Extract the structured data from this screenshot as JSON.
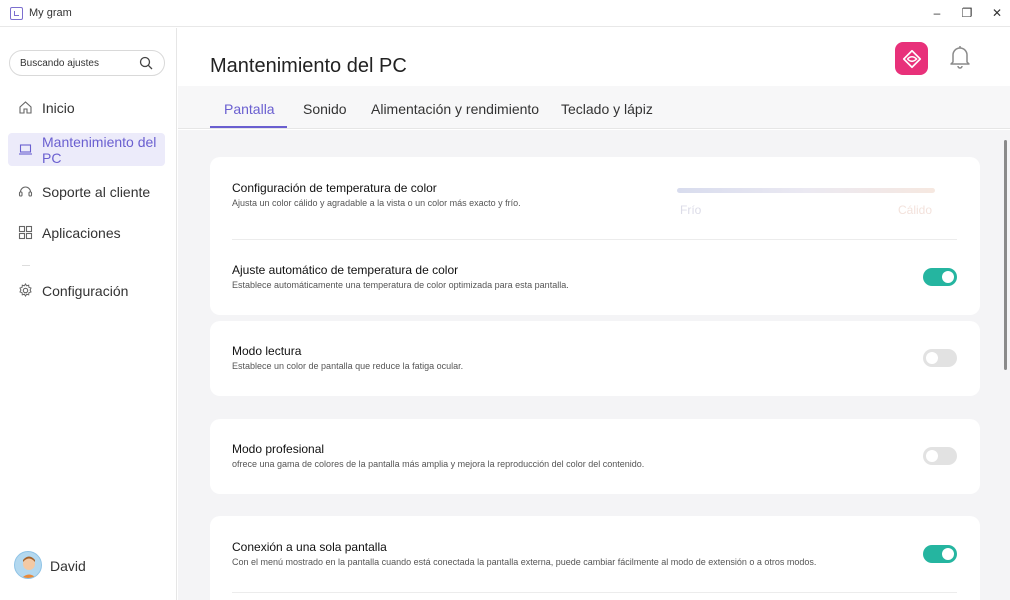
{
  "window": {
    "title": "My gram",
    "minimize": "–",
    "maximize": "❐",
    "close": "✕"
  },
  "sidebar": {
    "search_placeholder": "Buscando ajustes",
    "items": [
      {
        "label": "Inicio",
        "icon": "home-icon"
      },
      {
        "label": "Mantenimiento del PC",
        "icon": "laptop-icon",
        "active": true
      },
      {
        "label": "Soporte al cliente",
        "icon": "headset-icon"
      },
      {
        "label": "Aplicaciones",
        "icon": "grid-icon"
      },
      {
        "label": "Configuración",
        "icon": "gear-icon"
      }
    ],
    "user": {
      "name": "David"
    }
  },
  "header": {
    "title": "Mantenimiento del PC",
    "brand_icon": "brand-icon",
    "notification_icon": "bell-icon"
  },
  "tabs": [
    {
      "label": "Pantalla",
      "active": true
    },
    {
      "label": "Sonido"
    },
    {
      "label": "Alimentación y rendimiento"
    },
    {
      "label": "Teclado y lápiz"
    }
  ],
  "settings": {
    "color_temp": {
      "title": "Configuración de temperatura de color",
      "desc": "Ajusta un color cálido y agradable a la vista o un color más exacto y frío.",
      "cold_label": "Frío",
      "warm_label": "Cálido"
    },
    "auto_temp": {
      "title": "Ajuste automático de temperatura de color",
      "desc": "Establece automáticamente una temperatura de color optimizada para esta pantalla.",
      "enabled": true
    },
    "reading_mode": {
      "title": "Modo lectura",
      "desc": "Establece un color de pantalla que reduce la fatiga ocular.",
      "enabled": false
    },
    "pro_mode": {
      "title": "Modo profesional",
      "desc": "ofrece una gama de colores de la pantalla más amplia y mejora la reproducción del color del contenido.",
      "enabled": false
    },
    "single_display": {
      "title": "Conexión a una sola pantalla",
      "desc": "Con el menú mostrado en la pantalla cuando está conectada la pantalla externa, puede cambiar fácilmente al modo de extensión o a otros modos.",
      "enabled": true
    }
  },
  "colors": {
    "accent": "#6a5fd0",
    "toggle_on": "#25b5a0",
    "toggle_off": "#e2e2e2",
    "brand": "#e8317a"
  }
}
